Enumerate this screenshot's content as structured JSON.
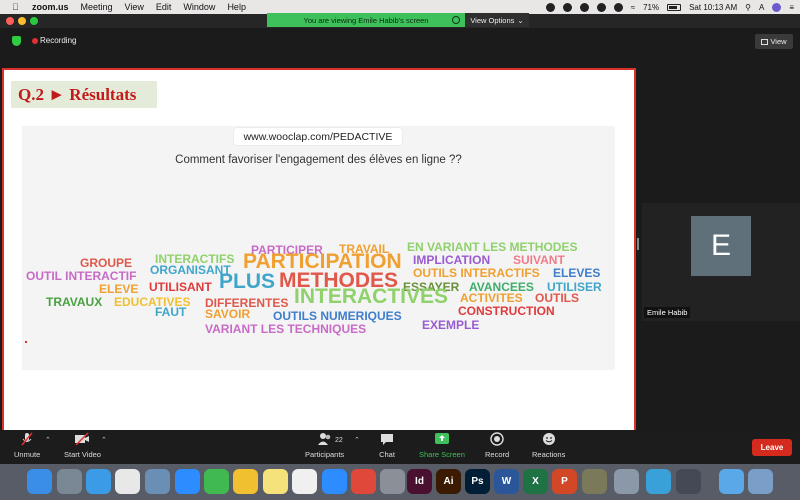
{
  "menubar": {
    "app": "zoom.us",
    "items": [
      "Meeting",
      "View",
      "Edit",
      "Window",
      "Help"
    ],
    "battery": "71%",
    "clock": "Sat 10:13 AM",
    "input_source": "A"
  },
  "banner": {
    "text": "You are viewing Emile Habib's screen",
    "view_options": "View Options"
  },
  "meeting": {
    "recording_label": "Recording",
    "view_label": "View"
  },
  "slide": {
    "title": "Q.2 ► Résultats",
    "url": "www.wooclap.com/PEDACTIVE",
    "question": "Comment favoriser l'engagement des élèves en ligne ??"
  },
  "wordcloud": {
    "words": [
      {
        "t": "GROUPE",
        "c": "#e0584a",
        "s": 12
      },
      {
        "t": "INTERACTIFS",
        "c": "#8fd16a",
        "s": 12
      },
      {
        "t": "PARTICIPER",
        "c": "#c86bc6",
        "s": 12
      },
      {
        "t": "TRAVAIL",
        "c": "#f0a030",
        "s": 12
      },
      {
        "t": "EN VARIANT LES METHODES",
        "c": "#8fd16a",
        "s": 12
      },
      {
        "t": "OUTIL INTERACTIF",
        "c": "#c86bc6",
        "s": 12
      },
      {
        "t": "ORGANISANT",
        "c": "#3fa6c9",
        "s": 12
      },
      {
        "t": "PARTICIPATION",
        "c": "#f0a030",
        "s": 21
      },
      {
        "t": "IMPLICATION",
        "c": "#9a5bd0",
        "s": 12
      },
      {
        "t": "SUIVANT",
        "c": "#f07b8a",
        "s": 12
      },
      {
        "t": "PLUS",
        "c": "#3fa6c9",
        "s": 21
      },
      {
        "t": "METHODES",
        "c": "#e0584a",
        "s": 21
      },
      {
        "t": "OUTILS INTERACTIFS",
        "c": "#f0a030",
        "s": 12
      },
      {
        "t": "ELEVES",
        "c": "#3f7ec9",
        "s": 12
      },
      {
        "t": "ELEVE",
        "c": "#f0a030",
        "s": 12
      },
      {
        "t": "UTILISANT",
        "c": "#e03a3a",
        "s": 12
      },
      {
        "t": "ESSAYER",
        "c": "#6a8f3a",
        "s": 12
      },
      {
        "t": "AVANCEES",
        "c": "#3fae6a",
        "s": 12
      },
      {
        "t": "UTILISER",
        "c": "#3fa6c9",
        "s": 12
      },
      {
        "t": "TRAVAUX",
        "c": "#4aa040",
        "s": 12
      },
      {
        "t": "EDUCATIVES",
        "c": "#f0c030",
        "s": 12
      },
      {
        "t": "INTERACTIVES",
        "c": "#8fd16a",
        "s": 21
      },
      {
        "t": "DIFFERENTES",
        "c": "#e0584a",
        "s": 12
      },
      {
        "t": "ACTIVITES",
        "c": "#f0a030",
        "s": 12
      },
      {
        "t": "OUTILS",
        "c": "#e0584a",
        "s": 12
      },
      {
        "t": "FAUT",
        "c": "#3fa6c9",
        "s": 12
      },
      {
        "t": "SAVOIR",
        "c": "#f0a030",
        "s": 12
      },
      {
        "t": "OUTILS NUMERIQUES",
        "c": "#3f7ec9",
        "s": 12
      },
      {
        "t": "CONSTRUCTION",
        "c": "#e03a3a",
        "s": 12
      },
      {
        "t": "EXEMPLE",
        "c": "#9a5bd0",
        "s": 12
      },
      {
        "t": "VARIANT LES TECHNIQUES",
        "c": "#c86bc6",
        "s": 12
      }
    ]
  },
  "participant": {
    "initial": "E",
    "name": "Emile Habib"
  },
  "controls": {
    "unmute": "Unmute",
    "start_video": "Start Video",
    "participants": "Participants",
    "participants_count": "22",
    "chat": "Chat",
    "share_screen": "Share Screen",
    "record": "Record",
    "reactions": "Reactions",
    "leave": "Leave"
  },
  "dock": {
    "apps": [
      {
        "name": "Finder",
        "c": "#3a8ee6",
        "l": ""
      },
      {
        "name": "Launchpad",
        "c": "#7a8795",
        "l": ""
      },
      {
        "name": "Safari",
        "c": "#3b9be6",
        "l": ""
      },
      {
        "name": "Chrome",
        "c": "#e8e8e8",
        "l": ""
      },
      {
        "name": "Preview",
        "c": "#6a8fb5",
        "l": ""
      },
      {
        "name": "Zoom",
        "c": "#2d8cff",
        "l": ""
      },
      {
        "name": "FaceTime",
        "c": "#3fb950",
        "l": ""
      },
      {
        "name": "Photos",
        "c": "#f0c030",
        "l": ""
      },
      {
        "name": "Notes",
        "c": "#f5e27a",
        "l": ""
      },
      {
        "name": "Music",
        "c": "#f0f0f0",
        "l": ""
      },
      {
        "name": "App Store",
        "c": "#2d8cff",
        "l": ""
      },
      {
        "name": "AnyDesk",
        "c": "#e0493a",
        "l": ""
      },
      {
        "name": "System Preferences",
        "c": "#8a8f98",
        "l": ""
      },
      {
        "name": "InDesign",
        "c": "#4a1030",
        "l": "Id"
      },
      {
        "name": "Illustrator",
        "c": "#3a1a00",
        "l": "Ai"
      },
      {
        "name": "Photoshop",
        "c": "#001e36",
        "l": "Ps"
      },
      {
        "name": "Word",
        "c": "#2b579a",
        "l": "W"
      },
      {
        "name": "Excel",
        "c": "#1f7244",
        "l": "X"
      },
      {
        "name": "PowerPoint",
        "c": "#d24726",
        "l": "P"
      },
      {
        "name": "Game",
        "c": "#7a7a5a",
        "l": ""
      },
      {
        "name": "Image Capture",
        "c": "#8a98a8",
        "l": ""
      },
      {
        "name": "Accessibility",
        "c": "#3aa0d8",
        "l": ""
      },
      {
        "name": "QuickTime",
        "c": "#444a55",
        "l": ""
      },
      {
        "name": "Finder Window",
        "c": "#5aa8e8",
        "l": ""
      },
      {
        "name": "Downloads",
        "c": "#7a9ec8",
        "l": ""
      },
      {
        "name": "Trash",
        "c": "#c8ccd2",
        "l": ""
      }
    ]
  }
}
